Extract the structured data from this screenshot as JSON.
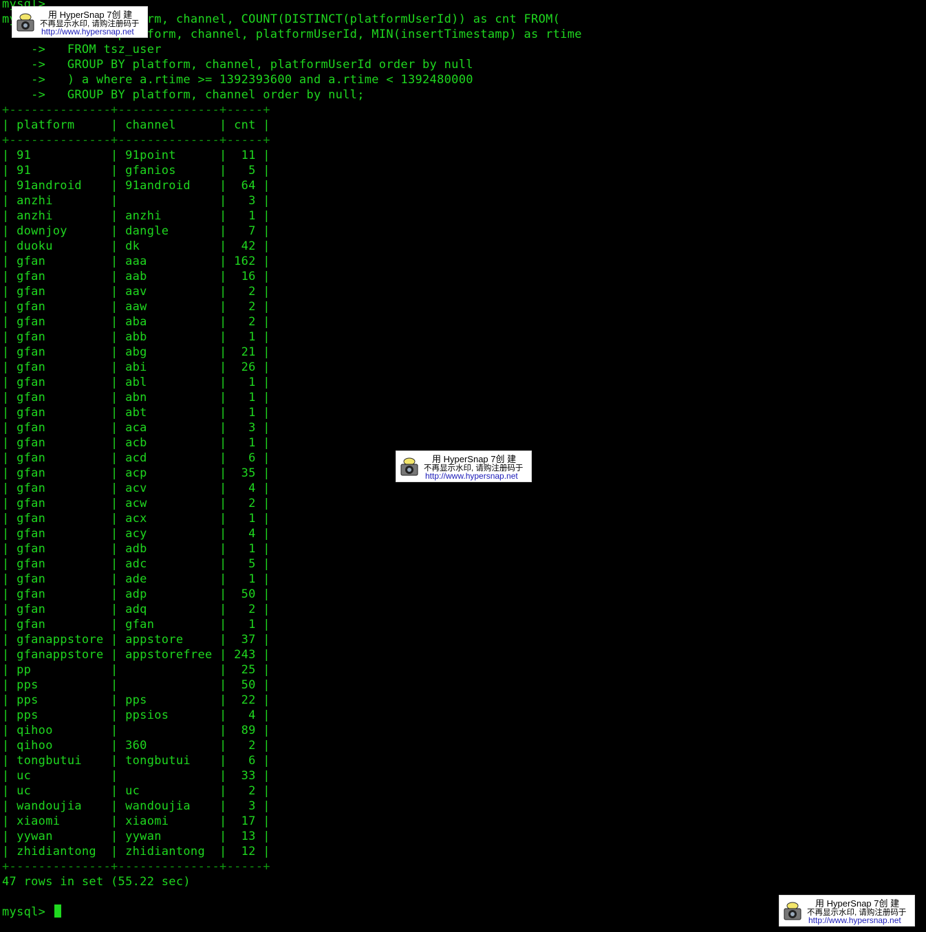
{
  "terminal": {
    "lines": [
      {
        "text": "mysql>"
      },
      {
        "text": "mysql> SELECT platform, channel, COUNT(DISTINCT(platformUserId)) as cnt FROM("
      },
      {
        "text": "    ->   SELECT platform, channel, platformUserId, MIN(insertTimestamp) as rtime"
      },
      {
        "text": "    ->   FROM tsz_user"
      },
      {
        "text": "    ->   GROUP BY platform, channel, platformUserId order by null"
      },
      {
        "text": "    ->   ) a where a.rtime >= 1392393600 and a.rtime < 1392480000"
      },
      {
        "text": "    ->   GROUP BY platform, channel order by null;"
      },
      {
        "text": "+--------------+--------------+-----+"
      },
      {
        "text": "| platform     | channel      | cnt |"
      },
      {
        "text": "+--------------+--------------+-----+"
      },
      {
        "text": "| 91           | 91point      |  11 |"
      },
      {
        "text": "| 91           | gfanios      |   5 |"
      },
      {
        "text": "| 91android    | 91android    |  64 |"
      },
      {
        "text": "| anzhi        |              |   3 |"
      },
      {
        "text": "| anzhi        | anzhi        |   1 |"
      },
      {
        "text": "| downjoy      | dangle       |   7 |"
      },
      {
        "text": "| duoku        | dk           |  42 |"
      },
      {
        "text": "| gfan         | aaa          | 162 |"
      },
      {
        "text": "| gfan         | aab          |  16 |"
      },
      {
        "text": "| gfan         | aav          |   2 |"
      },
      {
        "text": "| gfan         | aaw          |   2 |"
      },
      {
        "text": "| gfan         | aba          |   2 |"
      },
      {
        "text": "| gfan         | abb          |   1 |"
      },
      {
        "text": "| gfan         | abg          |  21 |"
      },
      {
        "text": "| gfan         | abi          |  26 |"
      },
      {
        "text": "| gfan         | abl          |   1 |"
      },
      {
        "text": "| gfan         | abn          |   1 |"
      },
      {
        "text": "| gfan         | abt          |   1 |"
      },
      {
        "text": "| gfan         | aca          |   3 |"
      },
      {
        "text": "| gfan         | acb          |   1 |"
      },
      {
        "text": "| gfan         | acd          |   6 |"
      },
      {
        "text": "| gfan         | acp          |  35 |"
      },
      {
        "text": "| gfan         | acv          |   4 |"
      },
      {
        "text": "| gfan         | acw          |   2 |"
      },
      {
        "text": "| gfan         | acx          |   1 |"
      },
      {
        "text": "| gfan         | acy          |   4 |"
      },
      {
        "text": "| gfan         | adb          |   1 |"
      },
      {
        "text": "| gfan         | adc          |   5 |"
      },
      {
        "text": "| gfan         | ade          |   1 |"
      },
      {
        "text": "| gfan         | adp          |  50 |"
      },
      {
        "text": "| gfan         | adq          |   2 |"
      },
      {
        "text": "| gfan         | gfan         |   1 |"
      },
      {
        "text": "| gfanappstore | appstore     |  37 |"
      },
      {
        "text": "| gfanappstore | appstorefree | 243 |"
      },
      {
        "text": "| pp           |              |  25 |"
      },
      {
        "text": "| pps          |              |  50 |"
      },
      {
        "text": "| pps          | pps          |  22 |"
      },
      {
        "text": "| pps          | ppsios       |   4 |"
      },
      {
        "text": "| qihoo        |              |  89 |"
      },
      {
        "text": "| qihoo        | 360          |   2 |"
      },
      {
        "text": "| tongbutui    | tongbutui    |   6 |"
      },
      {
        "text": "| uc           |              |  33 |"
      },
      {
        "text": "| uc           | uc           |   2 |"
      },
      {
        "text": "| wandoujia    | wandoujia    |   3 |"
      },
      {
        "text": "| xiaomi       | xiaomi       |  17 |"
      },
      {
        "text": "| yywan        | yywan        |  13 |"
      },
      {
        "text": "| zhidiantong  | zhidiantong  |  12 |"
      },
      {
        "text": "+--------------+--------------+-----+"
      },
      {
        "text": "47 rows in set (55.22 sec)"
      },
      {
        "text": ""
      },
      {
        "text": "mysql> "
      }
    ],
    "colors": {
      "foreground": "#1fd81f",
      "background": "#000000"
    }
  },
  "watermark": {
    "line1": "用 HyperSnap 7创 建",
    "line2": "不再显示水印, 请购注册码于",
    "url": "http://www.hypersnap.net",
    "icon": "camera-icon"
  }
}
